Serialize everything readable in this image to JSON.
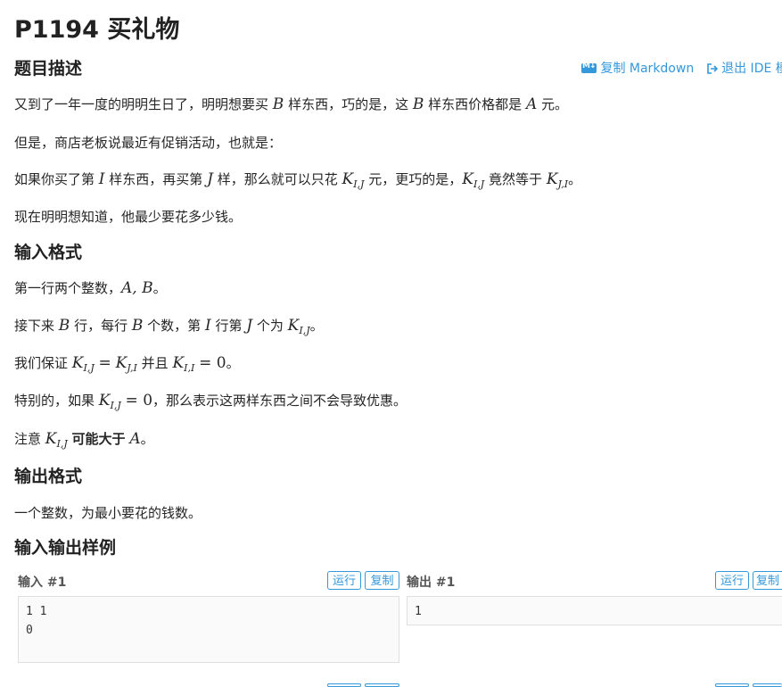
{
  "problem": {
    "title": "P1194 买礼物"
  },
  "toolbar": {
    "copy_markdown": "复制 Markdown",
    "exit_ide": "退出 IDE 模式"
  },
  "sections": {
    "description": "题目描述",
    "input_format": "输入格式",
    "output_format": "输出格式",
    "samples": "输入输出样例"
  },
  "desc": {
    "p1": {
      "a": "又到了一年一度的明明生日了，明明想要买",
      "v1": "B",
      "b": "样东西，巧的是，这",
      "v2": "B",
      "c": "样东西价格都是",
      "v3": "A",
      "d": "元。"
    },
    "p2": "但是，商店老板说最近有促销活动，也就是：",
    "p3": {
      "a": "如果你买了第",
      "v1": "I",
      "b": "样东西，再买第",
      "v2": "J",
      "c": "样，那么就可以只花",
      "v3": "K",
      "v3sub": "I,J",
      "d": "元，更巧的是，",
      "v4": "K",
      "v4sub": "I,J",
      "e": "竟然等于",
      "v5": "K",
      "v5sub": "J,I",
      "f": "。"
    },
    "p4": "现在明明想知道，他最少要花多少钱。"
  },
  "input": {
    "p1": {
      "a": "第一行两个整数，",
      "v1": "A, B",
      "b": "。"
    },
    "p2": {
      "a": "接下来",
      "v1": "B",
      "b": "行，每行",
      "v2": "B",
      "c": "个数，第",
      "v3": "I",
      "d": "行第",
      "v4": "J",
      "e": "个为",
      "v5": "K",
      "v5sub": "I,J",
      "f": "。"
    },
    "p3": {
      "a": "我们保证",
      "v1": "K",
      "v1sub": "I,J",
      "eq1": "=",
      "v2": "K",
      "v2sub": "J,I",
      "b": "并且",
      "v3": "K",
      "v3sub": "I,I",
      "eq2": "= 0",
      "c": "。"
    },
    "p4": {
      "a": "特别的，如果",
      "v1": "K",
      "v1sub": "I,J",
      "eq": "= 0",
      "b": "，那么表示这两样东西之间不会导致优惠。"
    },
    "p5": {
      "a": "注意",
      "v1": "K",
      "v1sub": "I,J",
      "strong": "可能大于",
      "v2": "A",
      "b": "。"
    }
  },
  "output": {
    "p1": "一个整数，为最小要花的钱数。"
  },
  "sample": {
    "input_label": "输入 #1",
    "output_label": "输出 #1",
    "run": "运行",
    "copy": "复制",
    "input_text": "1 1\n0",
    "output_text": "1"
  }
}
